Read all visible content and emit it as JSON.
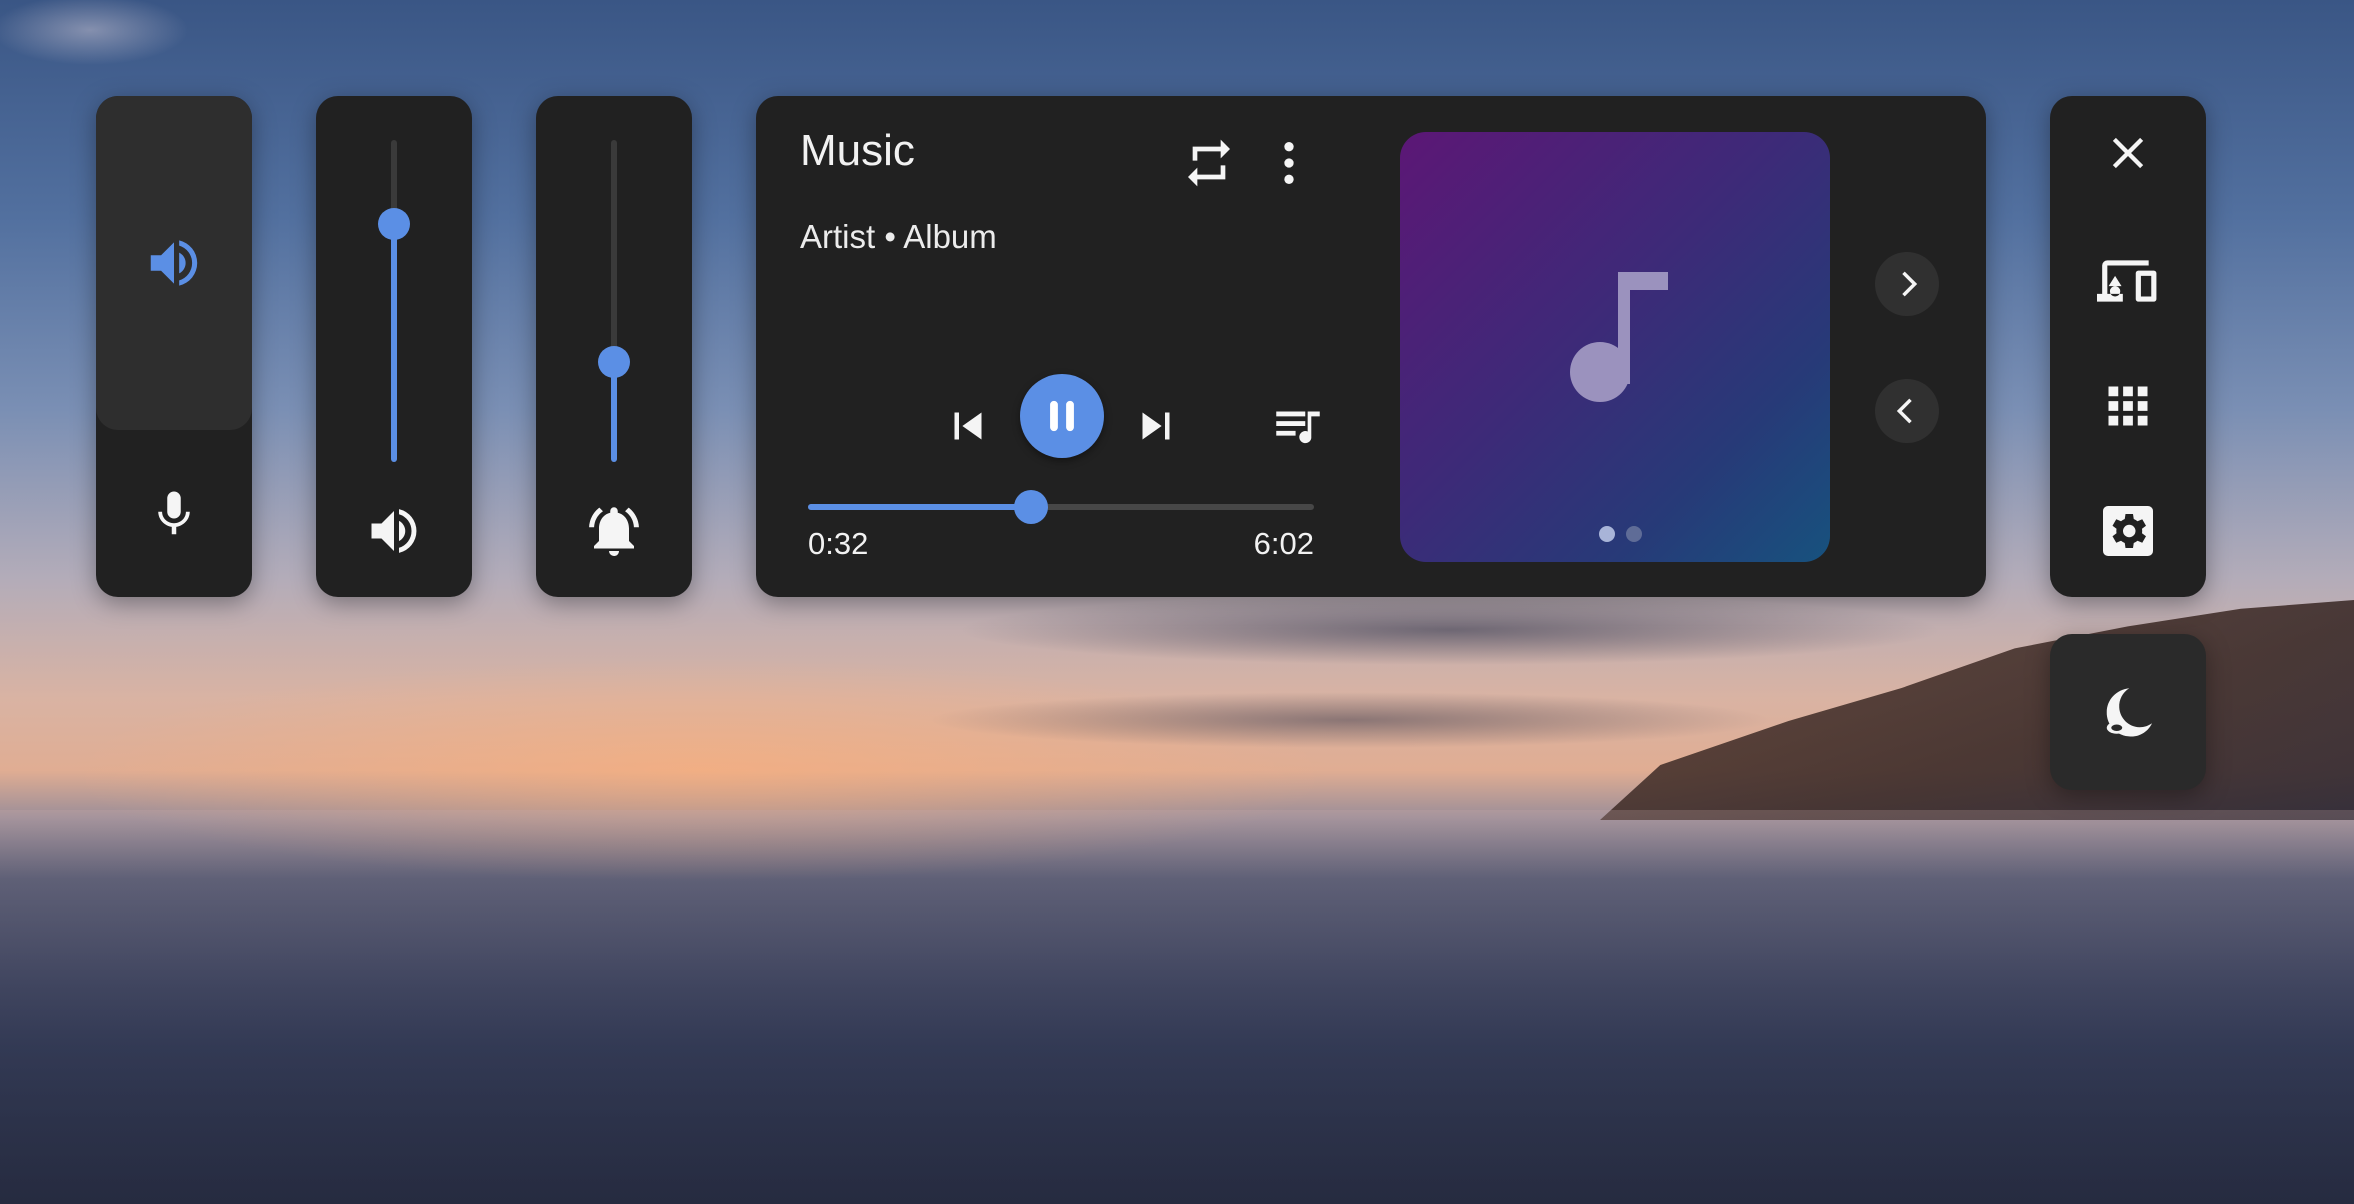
{
  "media": {
    "title": "Music",
    "subtitle": "Artist • Album",
    "elapsed": "0:32",
    "total": "6:02",
    "progress": 0.44,
    "playing": true,
    "album_art_icon": "music-note-icon",
    "pages": 2,
    "current_page": 1
  },
  "sliders": {
    "media_volume": 0.74,
    "ring_volume": 0.31
  },
  "colors": {
    "accent": "#5b8fe5",
    "panel": "#212121",
    "icon": "#f5f5f5"
  },
  "icons": {
    "output_speaker": "speaker-icon",
    "output_mic": "microphone-icon",
    "media_volume": "volume-icon",
    "ring_volume": "bell-icon",
    "repeat": "repeat-icon",
    "more": "more-vert-icon",
    "previous": "skip-previous-icon",
    "pause": "pause-icon",
    "next": "skip-next-icon",
    "queue": "queue-music-icon",
    "close": "close-icon",
    "devices": "devices-icon",
    "apps": "apps-grid-icon",
    "settings": "settings-gear-icon",
    "dark_mode": "dark-mode-icon"
  }
}
